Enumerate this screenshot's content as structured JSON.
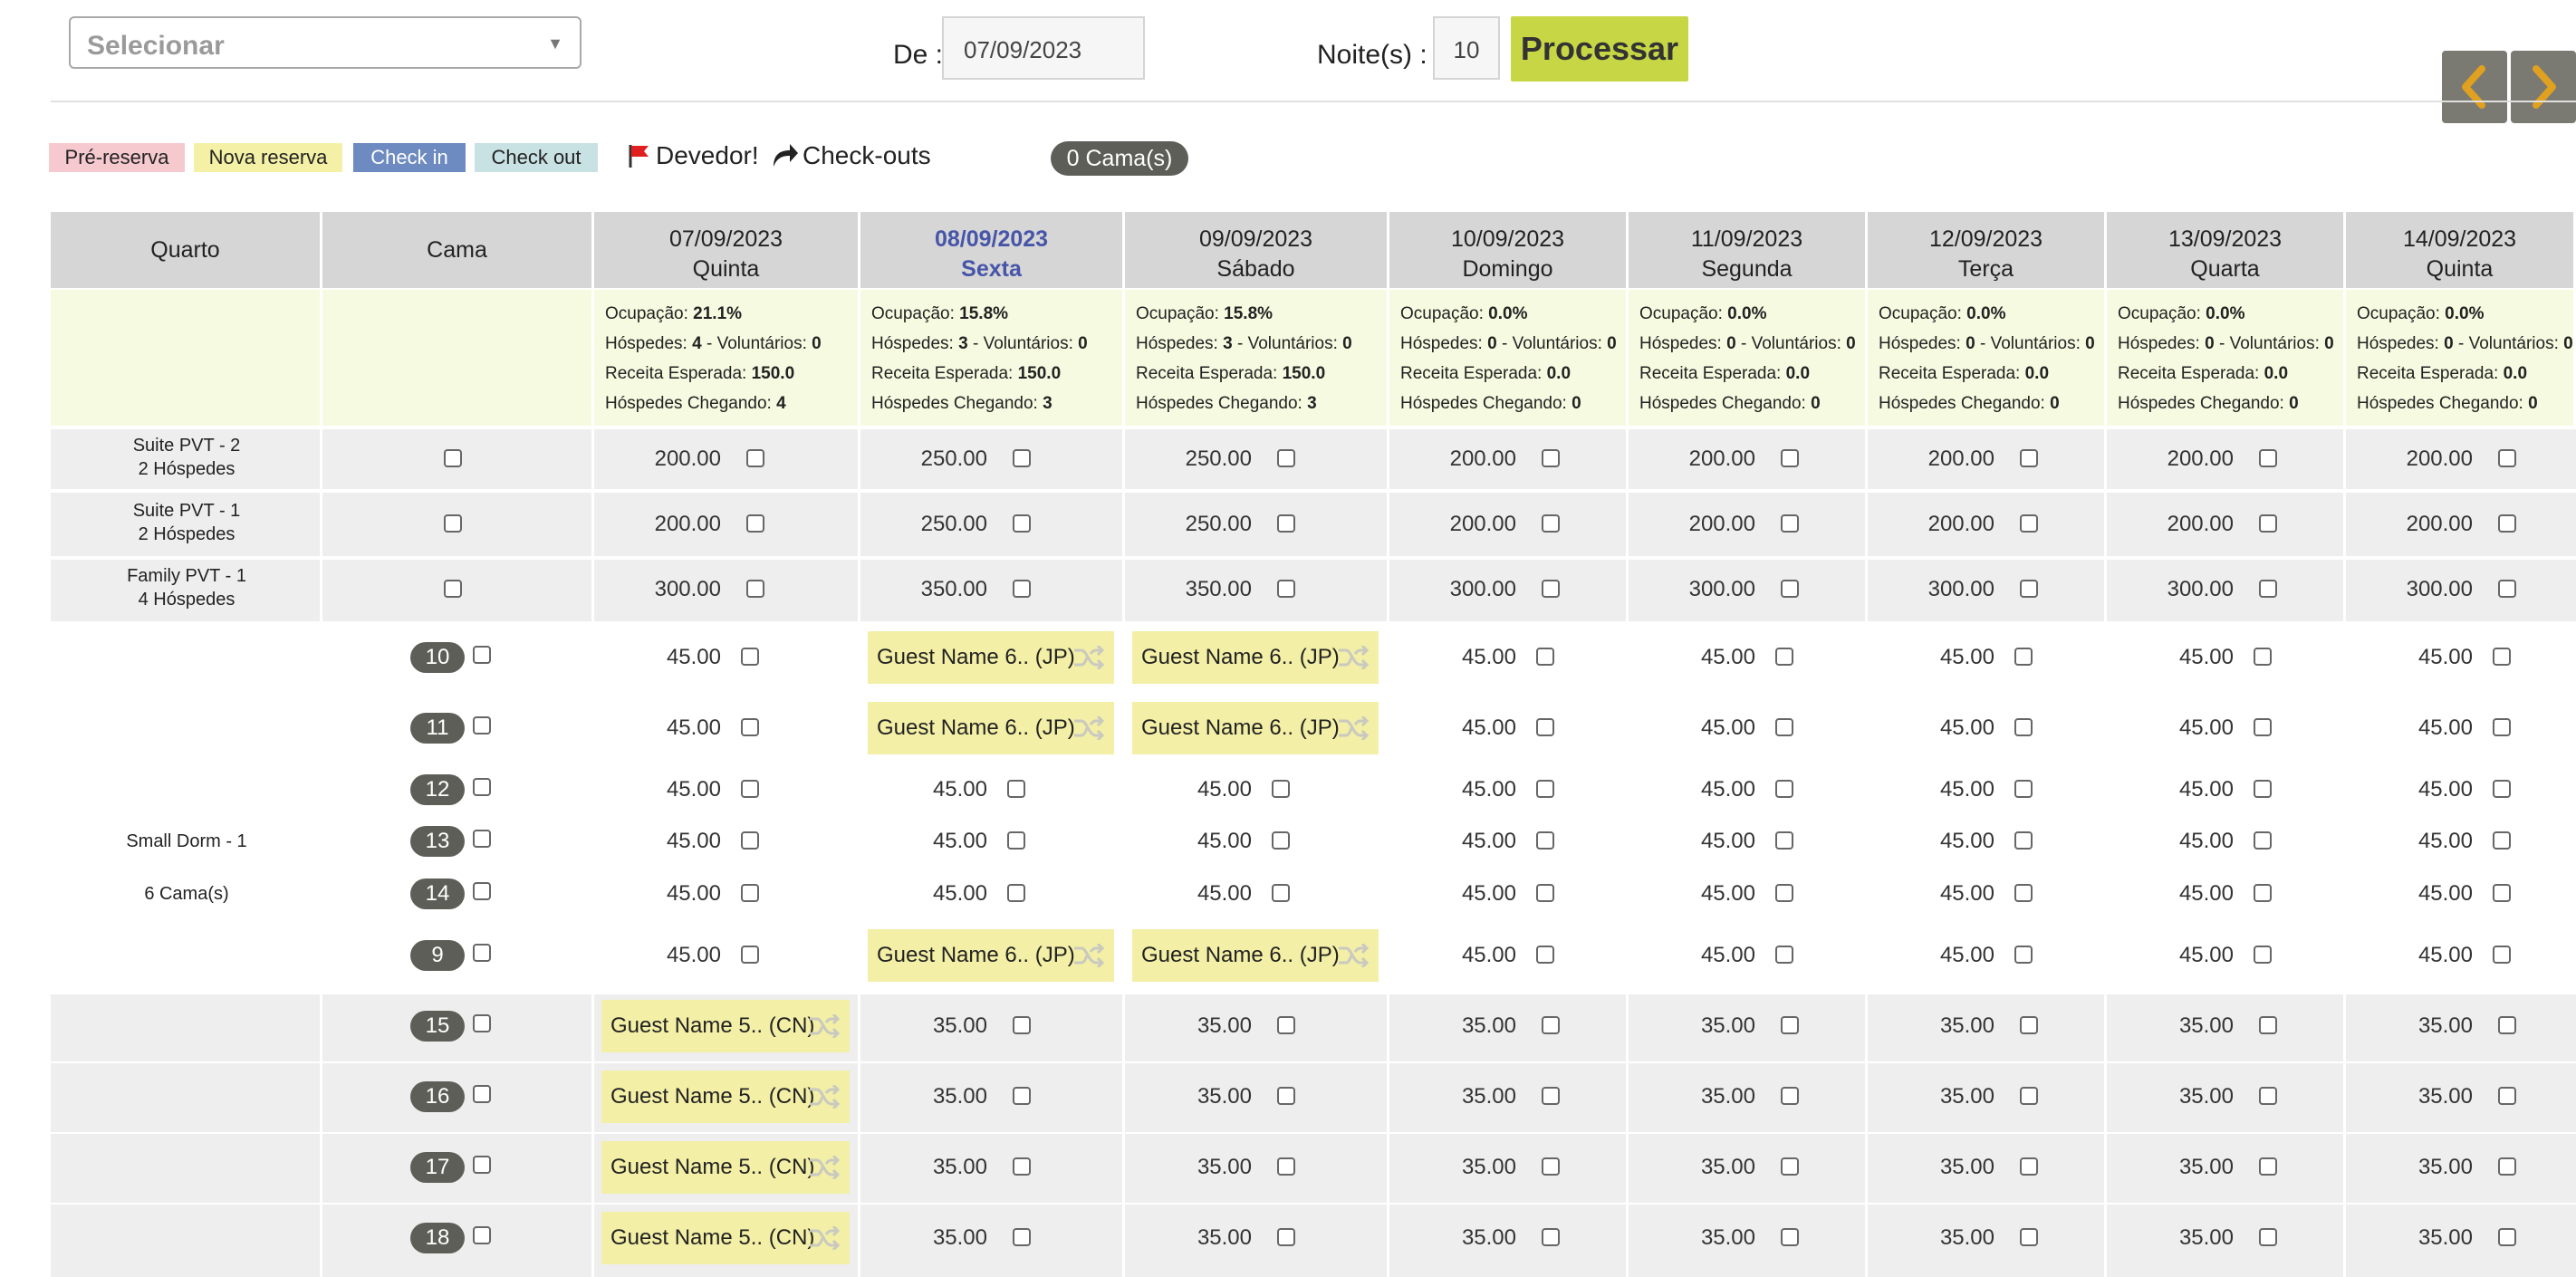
{
  "top": {
    "select_placeholder": "Selecionar",
    "de_label": "De :",
    "de_value": "07/09/2023",
    "noites_label": "Noite(s) :",
    "noites_value": "10",
    "processar_label": "Processar"
  },
  "legend": {
    "pre_reserva": "Pré-reserva",
    "nova_reserva": "Nova reserva",
    "check_in": "Check in",
    "check_out": "Check out",
    "devedor": "Devedor!",
    "checkouts": "Check-outs",
    "camas": "0 Cama(s)"
  },
  "colors": {
    "pre_reserva": "#f6c9cf",
    "nova_reserva": "#f4f1a6",
    "check_in": "#6d8bc1",
    "check_out": "#c8e1e3",
    "accent": "#c6d644",
    "selected_date": "#4655a8"
  },
  "table": {
    "col_quarto": "Quarto",
    "col_cama": "Cama",
    "dates": [
      {
        "date": "07/09/2023",
        "day": "Quinta",
        "ocup": "21.1%",
        "hosp": "4",
        "vol": "0",
        "rec": "150.0",
        "cheg": "4"
      },
      {
        "date": "08/09/2023",
        "day": "Sexta",
        "ocup": "15.8%",
        "hosp": "3",
        "vol": "0",
        "rec": "150.0",
        "cheg": "3"
      },
      {
        "date": "09/09/2023",
        "day": "Sábado",
        "ocup": "15.8%",
        "hosp": "3",
        "vol": "0",
        "rec": "150.0",
        "cheg": "3"
      },
      {
        "date": "10/09/2023",
        "day": "Domingo",
        "ocup": "0.0%",
        "hosp": "0",
        "vol": "0",
        "rec": "0.0",
        "cheg": "0"
      },
      {
        "date": "11/09/2023",
        "day": "Segunda",
        "ocup": "0.0%",
        "hosp": "0",
        "vol": "0",
        "rec": "0.0",
        "cheg": "0"
      },
      {
        "date": "12/09/2023",
        "day": "Terça",
        "ocup": "0.0%",
        "hosp": "0",
        "vol": "0",
        "rec": "0.0",
        "cheg": "0"
      },
      {
        "date": "13/09/2023",
        "day": "Quarta",
        "ocup": "0.0%",
        "hosp": "0",
        "vol": "0",
        "rec": "0.0",
        "cheg": "0"
      },
      {
        "date": "14/09/2023",
        "day": "Quinta",
        "ocup": "0.0%",
        "hosp": "0",
        "vol": "0",
        "rec": "0.0",
        "cheg": "0"
      }
    ],
    "stats_labels": {
      "ocup": "Ocupação: ",
      "hosp": "Hóspedes: ",
      "vol": " - Voluntários: ",
      "rec": "Receita Esperada: ",
      "cheg": "Hóspedes Chegando: "
    },
    "rooms": [
      {
        "name": "Suite PVT - 2",
        "cap": "2 Hóspedes",
        "prices": [
          "200.00",
          "250.00",
          "250.00",
          "200.00",
          "200.00",
          "200.00",
          "200.00",
          "200.00"
        ]
      },
      {
        "name": "Suite PVT - 1",
        "cap": "2 Hóspedes",
        "prices": [
          "200.00",
          "250.00",
          "250.00",
          "200.00",
          "200.00",
          "200.00",
          "200.00",
          "200.00"
        ]
      },
      {
        "name": "Family PVT - 1",
        "cap": "4 Hóspedes",
        "prices": [
          "300.00",
          "350.00",
          "350.00",
          "300.00",
          "300.00",
          "300.00",
          "300.00",
          "300.00"
        ]
      }
    ],
    "dorm": {
      "name": "Small Dorm - 1",
      "cap": "6 Cama(s)"
    },
    "dorm_beds": [
      {
        "bed": "10",
        "cells": [
          "45.00",
          "Guest Name 6.. (JP)",
          "Guest Name 6.. (JP)",
          "45.00",
          "45.00",
          "45.00",
          "45.00",
          "45.00"
        ]
      },
      {
        "bed": "11",
        "cells": [
          "45.00",
          "Guest Name 6.. (JP)",
          "Guest Name 6.. (JP)",
          "45.00",
          "45.00",
          "45.00",
          "45.00",
          "45.00"
        ]
      },
      {
        "bed": "12",
        "cells": [
          "45.00",
          "45.00",
          "45.00",
          "45.00",
          "45.00",
          "45.00",
          "45.00",
          "45.00"
        ]
      },
      {
        "bed": "13",
        "cells": [
          "45.00",
          "45.00",
          "45.00",
          "45.00",
          "45.00",
          "45.00",
          "45.00",
          "45.00"
        ]
      },
      {
        "bed": "14",
        "cells": [
          "45.00",
          "45.00",
          "45.00",
          "45.00",
          "45.00",
          "45.00",
          "45.00",
          "45.00"
        ]
      },
      {
        "bed": "9",
        "cells": [
          "45.00",
          "Guest Name 6.. (JP)",
          "Guest Name 6.. (JP)",
          "45.00",
          "45.00",
          "45.00",
          "45.00",
          "45.00"
        ]
      }
    ],
    "dorm2_beds": [
      {
        "bed": "15",
        "cells": [
          "Guest Name 5.. (CN)",
          "35.00",
          "35.00",
          "35.00",
          "35.00",
          "35.00",
          "35.00",
          "35.00"
        ]
      },
      {
        "bed": "16",
        "cells": [
          "Guest Name 5.. (CN)",
          "35.00",
          "35.00",
          "35.00",
          "35.00",
          "35.00",
          "35.00",
          "35.00"
        ]
      },
      {
        "bed": "17",
        "cells": [
          "Guest Name 5.. (CN)",
          "35.00",
          "35.00",
          "35.00",
          "35.00",
          "35.00",
          "35.00",
          "35.00"
        ]
      },
      {
        "bed": "18",
        "cells": [
          "Guest Name 5.. (CN)",
          "35.00",
          "35.00",
          "35.00",
          "35.00",
          "35.00",
          "35.00",
          "35.00"
        ]
      }
    ]
  }
}
